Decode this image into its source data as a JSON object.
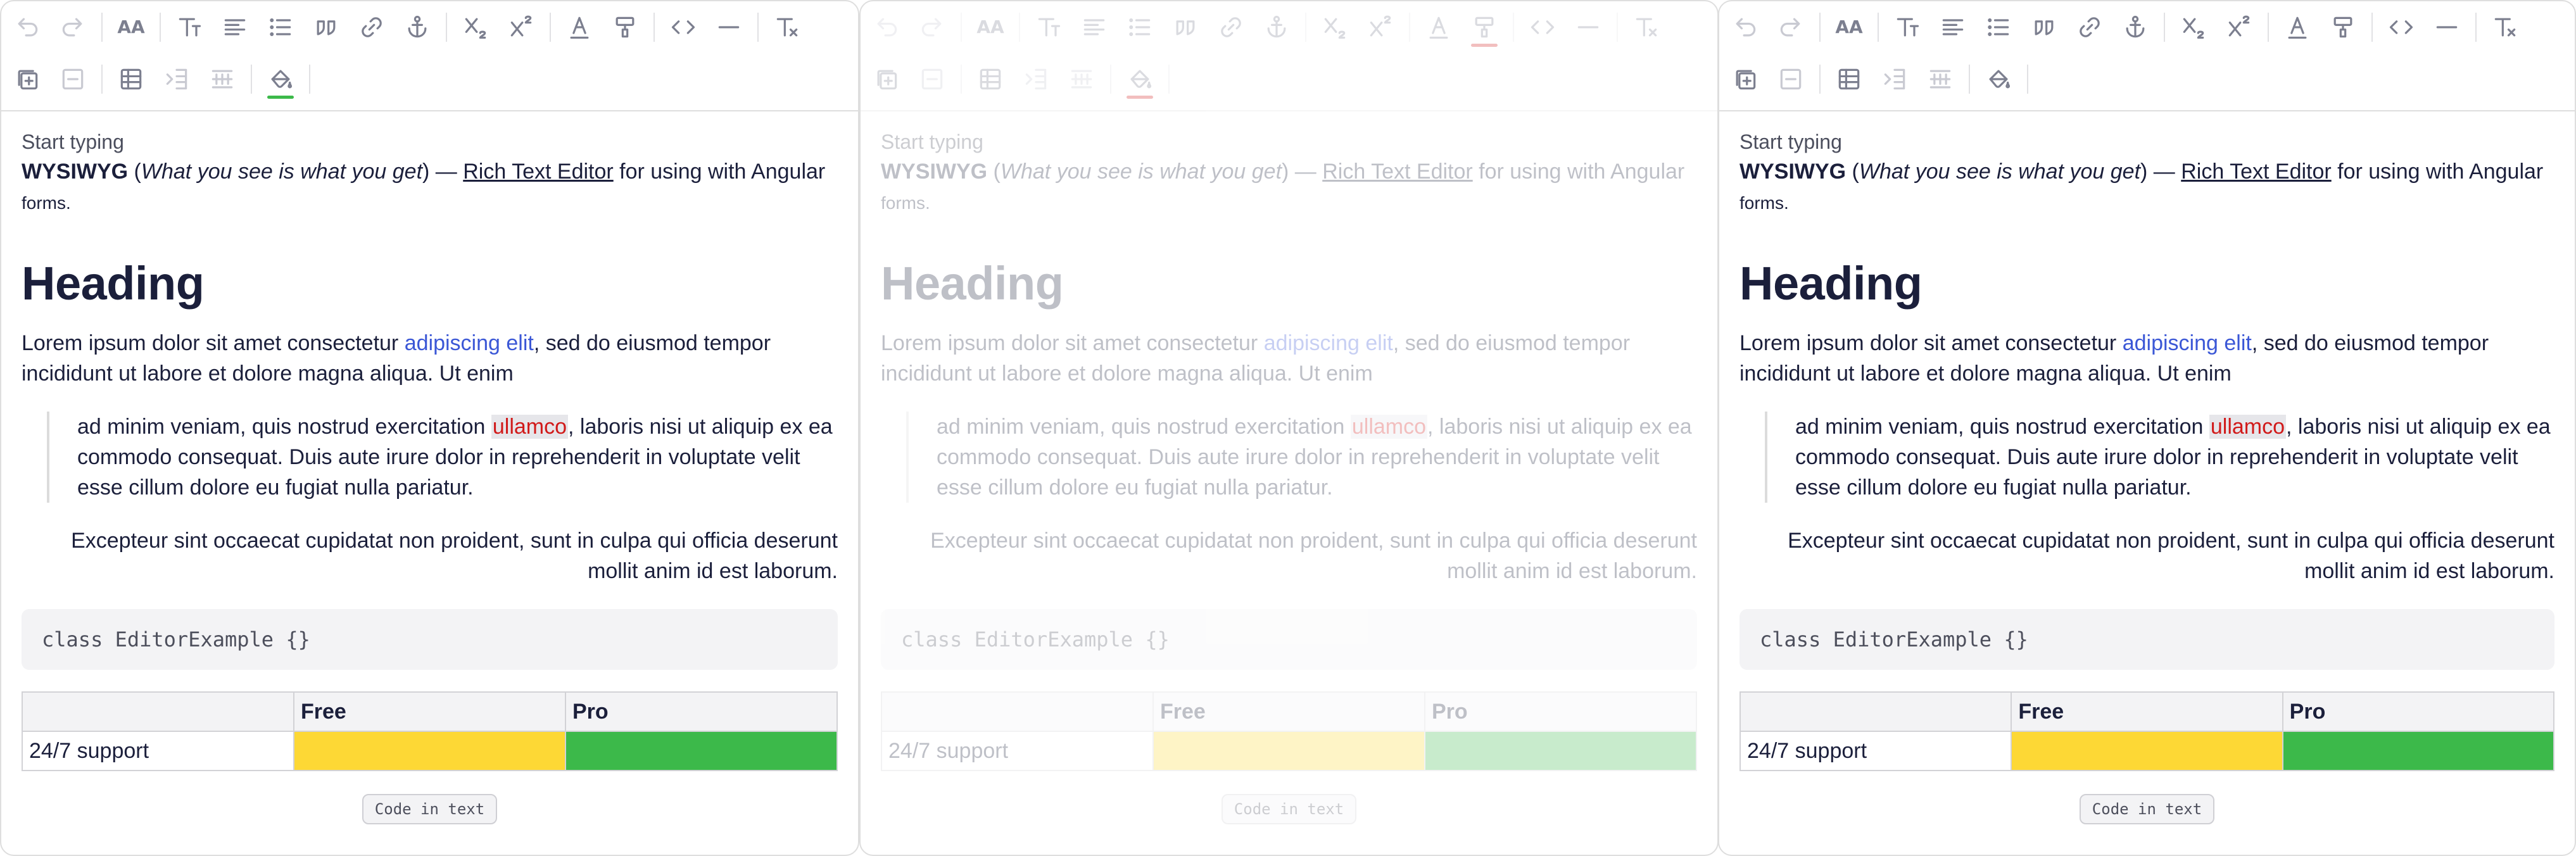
{
  "toolbar": {
    "row1": [
      "undo-icon",
      "redo-icon",
      "font-size-icon",
      "text-style-icon",
      "align-icon",
      "bulleted-list-icon",
      "blockquote-icon",
      "link-icon",
      "anchor-icon",
      "subscript-icon",
      "superscript-icon",
      "font-color-icon",
      "highlight-color-icon",
      "code-icon",
      "horizontal-rule-icon",
      "clear-format-icon"
    ],
    "row2": [
      "add-row-icon",
      "remove-row-icon",
      "insert-table-icon",
      "table-column-icon",
      "table-grid-icon",
      "cell-fill-icon"
    ],
    "font_size_glyph": "AA",
    "colors": {
      "cell_fill_underline": "#3cb94a",
      "highlight_underline": "#d11a1a",
      "table_fill_underline_disabled": "#d11a1a"
    }
  },
  "editor": {
    "placeholder": "Start typing",
    "intro": {
      "bold": "WYSIWYG",
      "open_paren": " (",
      "italic": "What you see is what you get",
      "close_dash": ") — ",
      "underline": "Rich Text Editor",
      "rest": " for using with Angular",
      "small": "forms."
    },
    "heading": "Heading",
    "paragraph": {
      "before": "Lorem ipsum dolor sit amet consectetur ",
      "link": "adipiscing elit",
      "after": ", sed do eiusmod tempor incididunt ut labore et dolore magna aliqua. Ut enim"
    },
    "quote": {
      "before": "ad minim veniam, quis nostrud exercitation ",
      "mark": "ullamco",
      "after": ", laboris nisi ut aliquip ex ea commodo consequat. Duis aute irure dolor in reprehenderit in voluptate velit esse cillum dolore eu fugiat nulla pariatur."
    },
    "right_paragraph": "Excepteur sint occaecat cupidatat non proident, sunt in culpa qui officia deserunt mollit anim id est laborum.",
    "code_block": "class EditorExample {}",
    "table": {
      "headers": [
        "",
        "Free",
        "Pro"
      ],
      "row_label": "24/7 support",
      "free_color": "#fdd835",
      "pro_color": "#3cb94a"
    },
    "chip": "Code in text"
  }
}
